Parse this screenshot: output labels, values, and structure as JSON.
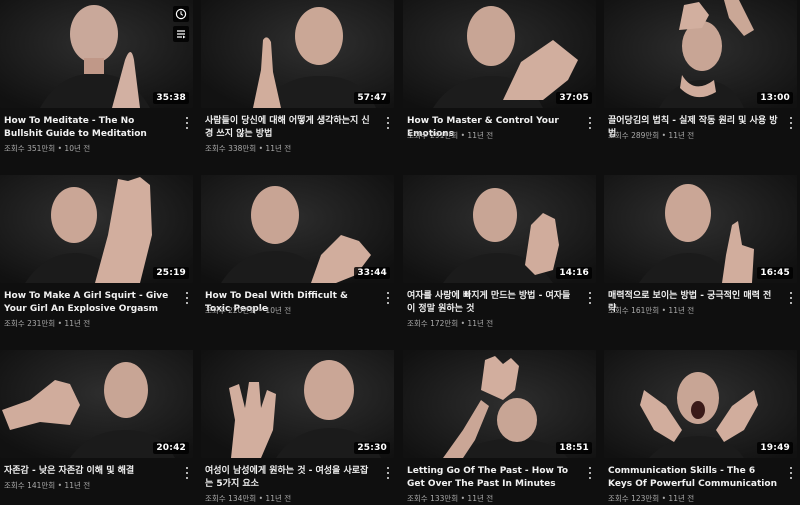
{
  "videos": [
    {
      "title": "How To Meditate - The No Bullshit Guide to Meditation",
      "views": "조회수 351만회",
      "age": "10년 전",
      "duration": "35:38"
    },
    {
      "title": "사람들이 당신에 대해 어떻게 생각하는지 신경 쓰지 않는 방법",
      "views": "조회수 338만회",
      "age": "11년 전",
      "duration": "57:47"
    },
    {
      "title": "How To Master & Control Your Emotions",
      "views": "조회수 291만회",
      "age": "11년 전",
      "duration": "37:05"
    },
    {
      "title": "끌어당김의 법칙 - 실제 작동 원리 및 사용 방법",
      "views": "조회수 289만회",
      "age": "11년 전",
      "duration": "13:00"
    },
    {
      "title": "How To Make A Girl Squirt - Give Your Girl An Explosive Orgasm",
      "views": "조회수 231만회",
      "age": "11년 전",
      "duration": "25:19"
    },
    {
      "title": "How To Deal With Difficult & Toxic People",
      "views": "조회수 220만회",
      "age": "10년 전",
      "duration": "33:44"
    },
    {
      "title": "여자를 사랑에 빠지게 만드는 방법 - 여자들이 정말 원하는 것",
      "views": "조회수 172만회",
      "age": "11년 전",
      "duration": "14:16"
    },
    {
      "title": "매력적으로 보이는 방법 - 궁극적인 매력 전략",
      "views": "조회수 161만회",
      "age": "11년 전",
      "duration": "16:45"
    },
    {
      "title": "자존감 - 낮은 자존감 이해 및 해결",
      "views": "조회수 141만회",
      "age": "11년 전",
      "duration": "20:42"
    },
    {
      "title": "여성이 남성에게 원하는 것 - 여성을 사로잡는 5가지 요소",
      "views": "조회수 134만회",
      "age": "11년 전",
      "duration": "25:30"
    },
    {
      "title": "Letting Go Of The Past - How To Get Over The Past In Minutes",
      "views": "조회수 133만회",
      "age": "11년 전",
      "duration": "18:51"
    },
    {
      "title": "Communication Skills - The 6 Keys Of Powerful Communication",
      "views": "조회수 123만회",
      "age": "11년 전",
      "duration": "19:49"
    }
  ],
  "separator": "•",
  "icons": {
    "watch_later": "clock-icon",
    "add_to_queue": "playlist-add-icon",
    "menu": "more-vert-icon"
  },
  "colors": {
    "background": "#0f0f0f",
    "title": "#f1f1f1",
    "meta": "#aaaaaa",
    "badge": "#000000"
  }
}
